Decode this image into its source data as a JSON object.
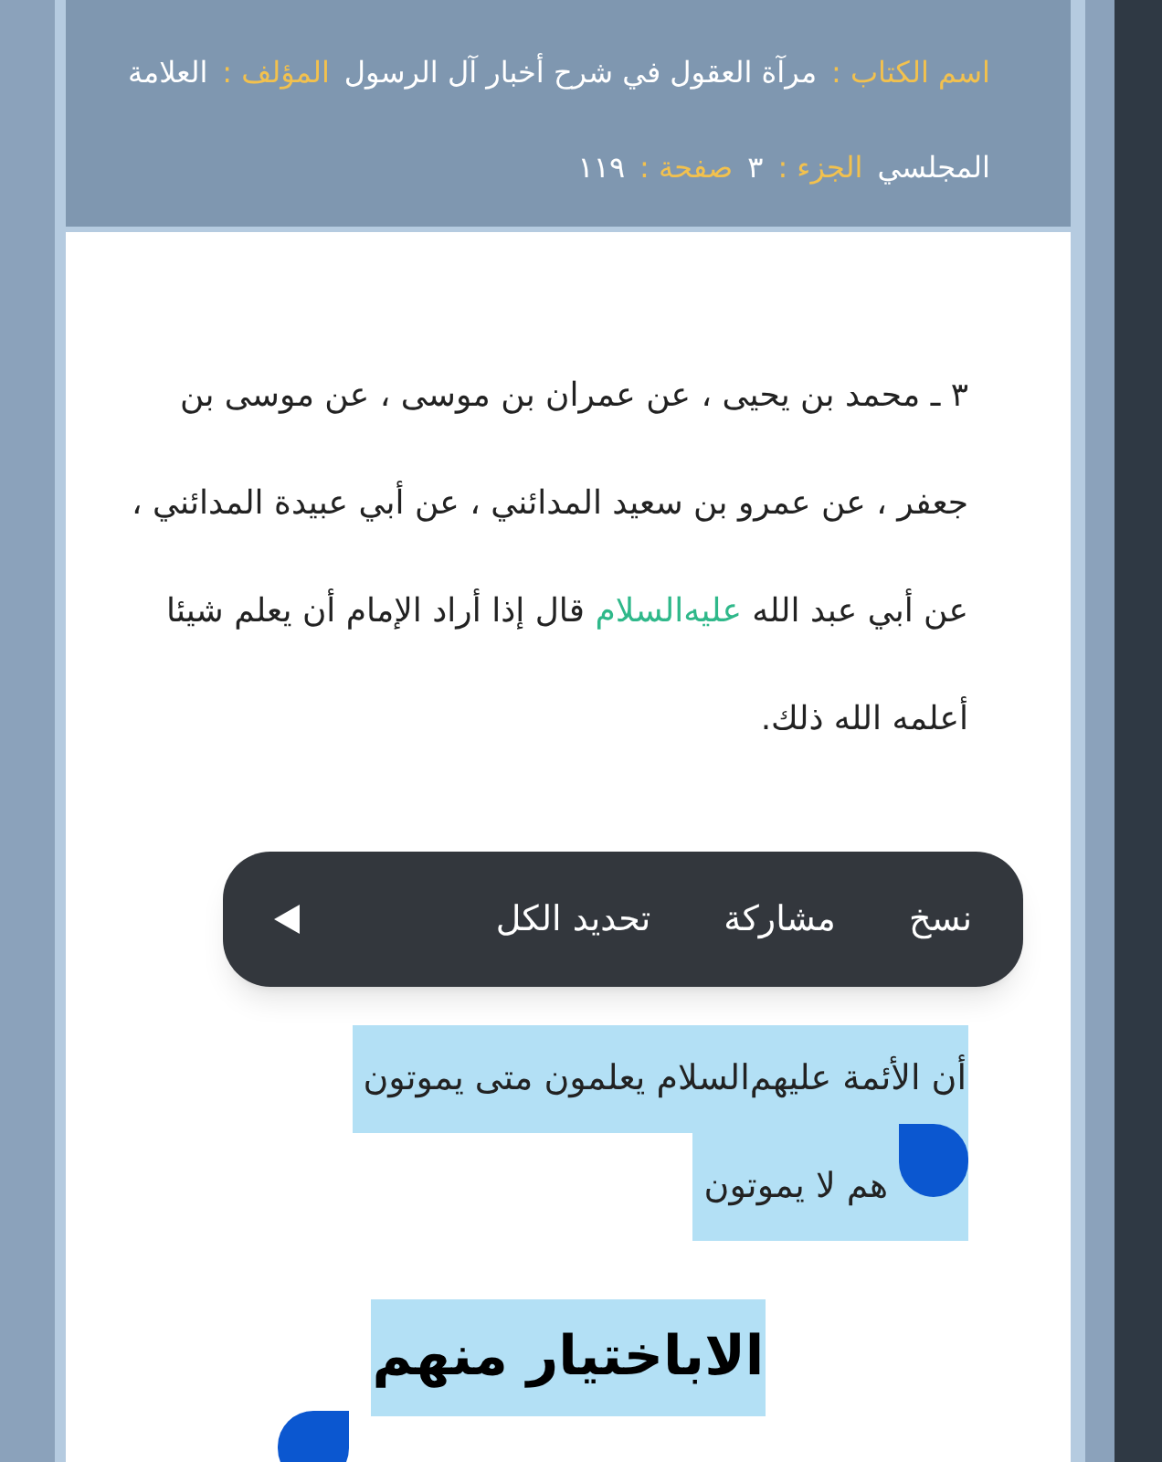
{
  "header": {
    "segments": [
      {
        "kind": "label",
        "text": "اسم الكتاب :"
      },
      {
        "kind": "value",
        "text": "مرآة العقول في شرح أخبار آل الرسول"
      },
      {
        "kind": "label",
        "text": "المؤلف :"
      },
      {
        "kind": "value",
        "text": "العلامة"
      },
      {
        "kind": "value",
        "text": "المجلسي"
      },
      {
        "kind": "label",
        "text": "الجزء :"
      },
      {
        "kind": "value",
        "text": "٣"
      },
      {
        "kind": "label",
        "text": "صفحة :"
      },
      {
        "kind": "value",
        "text": "١١٩"
      }
    ]
  },
  "hadith": {
    "segments": [
      {
        "kind": "text",
        "text": "٣ ـ محمد بن يحيى ، عن عمران بن موسى ، عن موسى بن جعفر ، عن عمرو بن سعيد المدائني ، عن أبي عبيدة المدائني ، عن أبي عبد الله "
      },
      {
        "kind": "honorific",
        "text": "عليه‌السلام"
      },
      {
        "kind": "text",
        "text": " قال إذا أراد الإمام أن يعلم شيئا أعلمه الله ذلك."
      }
    ]
  },
  "selection_menu": {
    "items": [
      {
        "label": "نسخ"
      },
      {
        "label": "مشاركة"
      },
      {
        "label": "تحديد الكل"
      }
    ]
  },
  "selected_text": {
    "selected": true,
    "lines": [
      "أن الأئمة عليهم‌السلام يعلمون متى يموتون",
      "هم لا يموتون"
    ]
  },
  "heading": {
    "text": "الاباختيار منهم",
    "selected": true
  }
}
